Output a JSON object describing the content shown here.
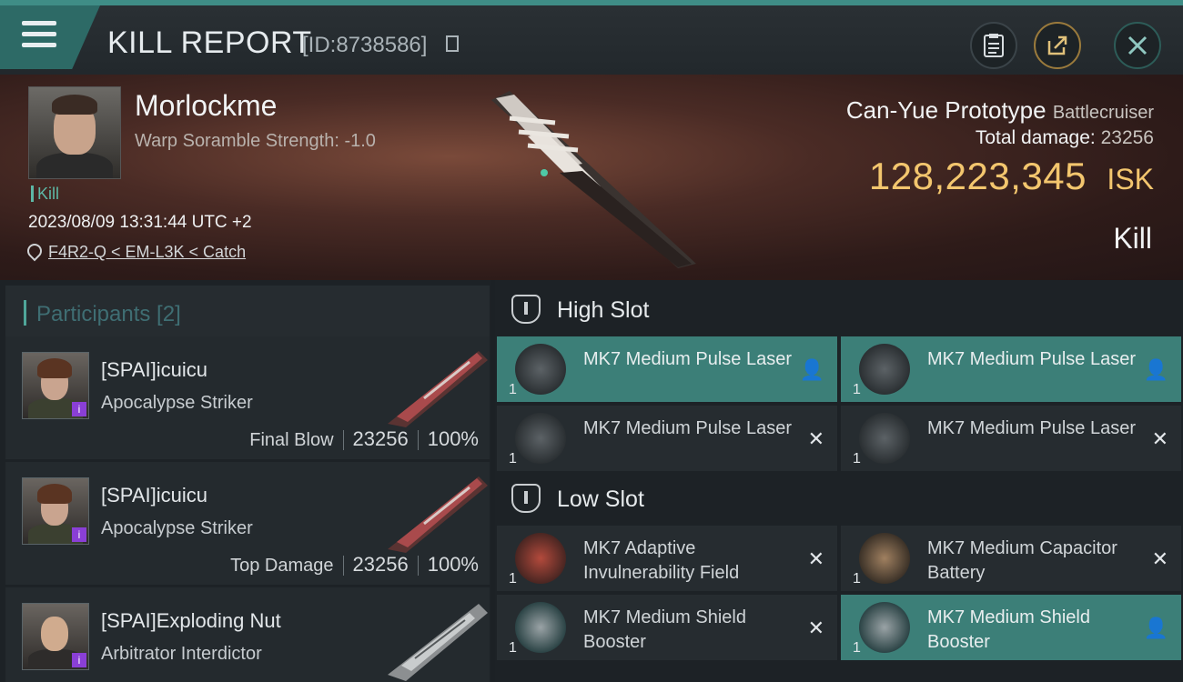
{
  "header": {
    "title": "KILL REPORT",
    "report_id": "[ID:8738586]"
  },
  "victim": {
    "name": "Morlockme",
    "warp_scramble": "Warp Soramble Strength: -1.0",
    "tag": "Kill",
    "datetime": "2023/08/09 13:31:44 UTC +2",
    "location": "F4R2-Q < EM-L3K < Catch",
    "ship_name": "Can-Yue Prototype",
    "ship_class": "Battlecruiser",
    "damage_label": "Total damage:",
    "damage_value": "23256",
    "isk_value": "128,223,345",
    "isk_unit": "ISK",
    "result": "Kill"
  },
  "participants": {
    "title": "Participants [2]",
    "items": [
      {
        "name": "[SPAI]icuicu",
        "ship": "Apocalypse Striker",
        "role": "Final Blow",
        "damage": "23256",
        "percent": "100%",
        "badge": "i"
      },
      {
        "name": "[SPAI]icuicu",
        "ship": "Apocalypse Striker",
        "role": "Top Damage",
        "damage": "23256",
        "percent": "100%",
        "badge": "i"
      },
      {
        "name": "[SPAI]Exploding Nut",
        "ship": "Arbitrator Interdictor",
        "role": "",
        "damage": "",
        "percent": "",
        "badge": "i"
      }
    ]
  },
  "fitting": {
    "high_slot": {
      "title": "High Slot",
      "modules": [
        {
          "name": "MK7 Medium Pulse Laser",
          "qty": "1",
          "state": "person"
        },
        {
          "name": "MK7 Medium Pulse Laser",
          "qty": "1",
          "state": "person"
        },
        {
          "name": "MK7 Medium Pulse Laser",
          "qty": "1",
          "state": "destroyed"
        },
        {
          "name": "MK7 Medium Pulse Laser",
          "qty": "1",
          "state": "destroyed"
        }
      ]
    },
    "low_slot": {
      "title": "Low Slot",
      "modules": [
        {
          "name": "MK7 Adaptive Invulnerability Field",
          "qty": "1",
          "state": "destroyed"
        },
        {
          "name": "MK7 Medium Capacitor Battery",
          "qty": "1",
          "state": "destroyed"
        },
        {
          "name": "MK7 Medium Shield Booster",
          "qty": "1",
          "state": "destroyed"
        },
        {
          "name": "MK7 Medium Shield Booster",
          "qty": "1",
          "state": "person"
        }
      ]
    },
    "glyphs": {
      "destroyed": "✕",
      "person": "👤"
    }
  },
  "icons": [
    "menu-icon",
    "copy-icon",
    "clipboard-icon",
    "share-icon",
    "close-icon",
    "location-pin-icon",
    "slot-icon",
    "person-icon",
    "destroyed-icon"
  ],
  "colors": {
    "accent": "#3f8d86",
    "isk": "#f3c66e",
    "active_module": "#3c7f78",
    "kill_tag": "#5db8a6"
  }
}
